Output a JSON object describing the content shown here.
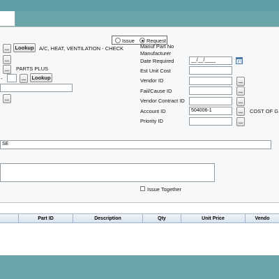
{
  "mode_toggle": {
    "issue_label": "Issue",
    "request_label": "Request",
    "selected": "Request"
  },
  "left_form": {
    "lookup_label": "Lookup",
    "ahu_description": "A/C, HEAT, VENTILATION - CHECK",
    "parts_plus_text": "PARTS PLUS",
    "dash_text": "-",
    "dots_label": "...",
    "description_value": "SE"
  },
  "right_form": {
    "manuf_part_no_label": "Manuf Part No",
    "manufacturer_label": "Manufacturer",
    "date_required_label": "Date Required",
    "date_required_value": "__/__/____",
    "est_unit_cost_label": "Est Unit Cost",
    "vendor_id_label": "Vendor ID",
    "fail_cause_id_label": "Fail/Cause ID",
    "vendor_contract_id_label": "Vendor Contract ID",
    "account_id_label": "Account ID",
    "account_id_value": "504006-1",
    "cost_of_text": "COST OF G",
    "priority_id_label": "Priority ID"
  },
  "issue_together_label": "Issue Together",
  "table": {
    "columns": [
      "Part ID",
      "Description",
      "Qty",
      "Unit Price",
      "Vendo"
    ]
  },
  "colors": {
    "frame": "#6aa3a8",
    "panel": "#f7f8f9",
    "header": "#d8e2ee"
  }
}
